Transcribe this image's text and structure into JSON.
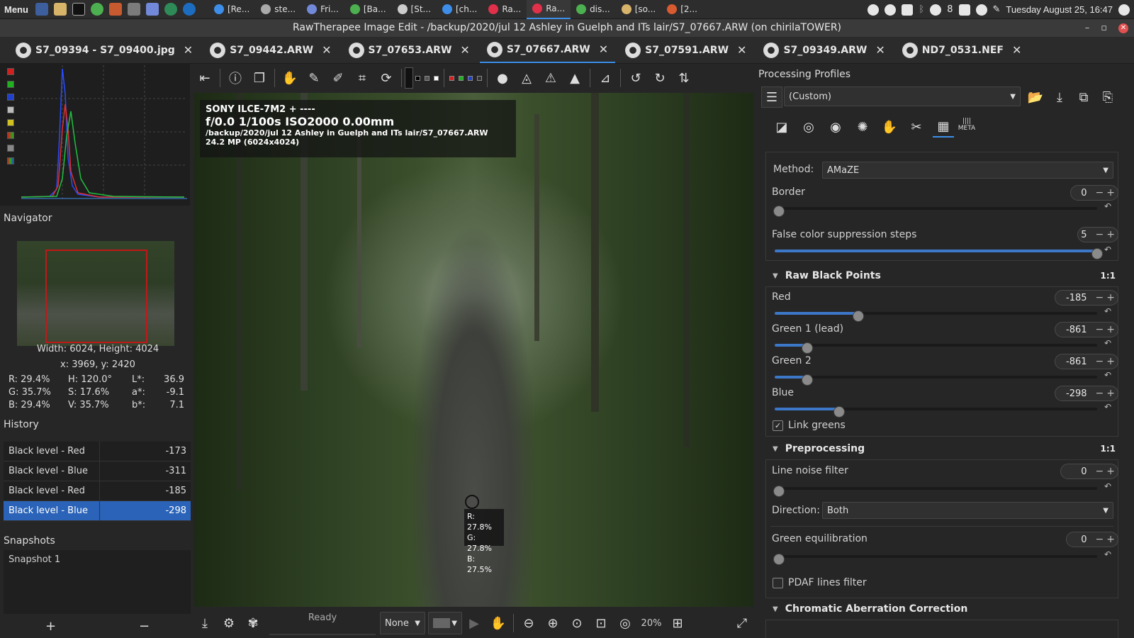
{
  "taskbar": {
    "menu_label": "Menu",
    "tasks": [
      {
        "label": "[Re...",
        "color": "#3d8ee8"
      },
      {
        "label": "ste...",
        "color": "#aaaaaa"
      },
      {
        "label": "Fri...",
        "color": "#7289da"
      },
      {
        "label": "[Ba...",
        "color": "#4caf50"
      },
      {
        "label": "[St...",
        "color": "#cccccc"
      },
      {
        "label": "[ch...",
        "color": "#3d8ee8"
      },
      {
        "label": "Ra...",
        "color": "#e0304a"
      },
      {
        "label": "Ra...",
        "color": "#e0304a"
      },
      {
        "label": "dis...",
        "color": "#4caf50"
      },
      {
        "label": "[so...",
        "color": "#d8b46a"
      },
      {
        "label": "[2...",
        "color": "#d85a30"
      }
    ],
    "tray_count": "8",
    "clock": "Tuesday August 25, 16:47"
  },
  "window": {
    "title": "RawTherapee Image Edit - /backup/2020/jul 12 Ashley in Guelph and ITs lair/S7_07667.ARW (on chirilaTOWER)"
  },
  "tabs": [
    {
      "label": "S7_09394 - S7_09400.jpg"
    },
    {
      "label": "S7_09442.ARW"
    },
    {
      "label": "S7_07653.ARW"
    },
    {
      "label": "S7_07667.ARW"
    },
    {
      "label": "S7_07591.ARW"
    },
    {
      "label": "S7_09349.ARW"
    },
    {
      "label": "ND7_0531.NEF"
    }
  ],
  "left": {
    "navigator_title": "Navigator",
    "size_text": "Width: 6024, Height: 4024",
    "coords_text": "x: 3969, y: 2420",
    "values": {
      "r": "R:  29.4%",
      "g": "G:  35.7%",
      "b": "B:  29.4%",
      "h": "H:  120.0°",
      "s": "S:  17.6%",
      "v": "V:  35.7%",
      "l_label": "L*:",
      "l": "36.9",
      "a_label": "a*:",
      "a": "-9.1",
      "bb_label": "b*:",
      "bb": "7.1"
    },
    "history_title": "History",
    "history": [
      {
        "name": "Black level - Red",
        "value": "-173"
      },
      {
        "name": "Black level - Blue",
        "value": "-311"
      },
      {
        "name": "Black level - Red",
        "value": "-185"
      },
      {
        "name": "Black level - Blue",
        "value": "-298"
      }
    ],
    "snapshots_title": "Snapshots",
    "snapshot": "Snapshot 1",
    "add_label": "+",
    "remove_label": "−"
  },
  "overlay": {
    "line1": "SONY ILCE-7M2 + ----",
    "line2": "f/0.0  1/100s  ISO2000  0.00mm",
    "line3": "/backup/2020/jul 12 Ashley in Guelph and ITs lair/S7_07667.ARW",
    "line4": "24.2 MP (6024x4024)"
  },
  "picker": {
    "r": "R: 27.8%",
    "g": "G: 27.8%",
    "b": "B: 27.5%"
  },
  "bottom": {
    "status": "Ready",
    "none_label": "None",
    "zoom": "20%"
  },
  "right": {
    "profiles_title": "Processing Profiles",
    "profile_value": "(Custom)",
    "method_label": "Method:",
    "method_value": "AMaZE",
    "border_label": "Border",
    "border_value": "0",
    "fcs_label": "False color suppression steps",
    "fcs_value": "5",
    "fcs_level": 1.0,
    "rbp_title": "Raw Black Points",
    "rbp_ratio": "1:1",
    "red_label": "Red",
    "red_value": "-185",
    "red_level": 0.26,
    "g1_label": "Green 1 (lead)",
    "g1_value": "-861",
    "g1_level": 0.1,
    "g2_label": "Green 2",
    "g2_value": "-861",
    "g2_level": 0.1,
    "blue_label": "Blue",
    "blue_value": "-298",
    "blue_level": 0.2,
    "link_greens": "Link greens",
    "pre_title": "Preprocessing",
    "pre_ratio": "1:1",
    "lnf_label": "Line noise filter",
    "lnf_value": "0",
    "dir_label": "Direction:",
    "dir_value": "Both",
    "geq_label": "Green equilibration",
    "geq_value": "0",
    "pdaf_label": "PDAF lines filter",
    "cac_title": "Chromatic Aberration Correction",
    "meta_label": "META"
  }
}
